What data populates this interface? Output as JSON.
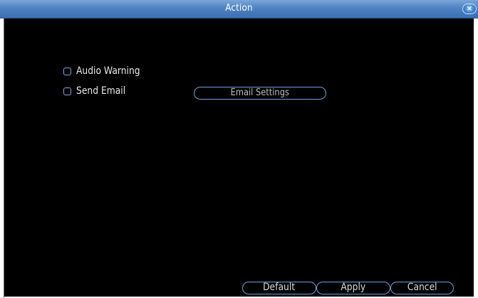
{
  "window": {
    "title": "Action",
    "close_glyph": "×"
  },
  "options": {
    "audio_warning": {
      "label": "Audio Warning",
      "checked": false
    },
    "send_email": {
      "label": "Send Email",
      "checked": false
    }
  },
  "buttons": {
    "email_settings": "Email Settings",
    "default": "Default",
    "apply": "Apply",
    "cancel": "Cancel"
  },
  "colors": {
    "titlebar": "#4f82c2",
    "accent_border": "#6fa0dc",
    "panel_background": "#000000"
  }
}
